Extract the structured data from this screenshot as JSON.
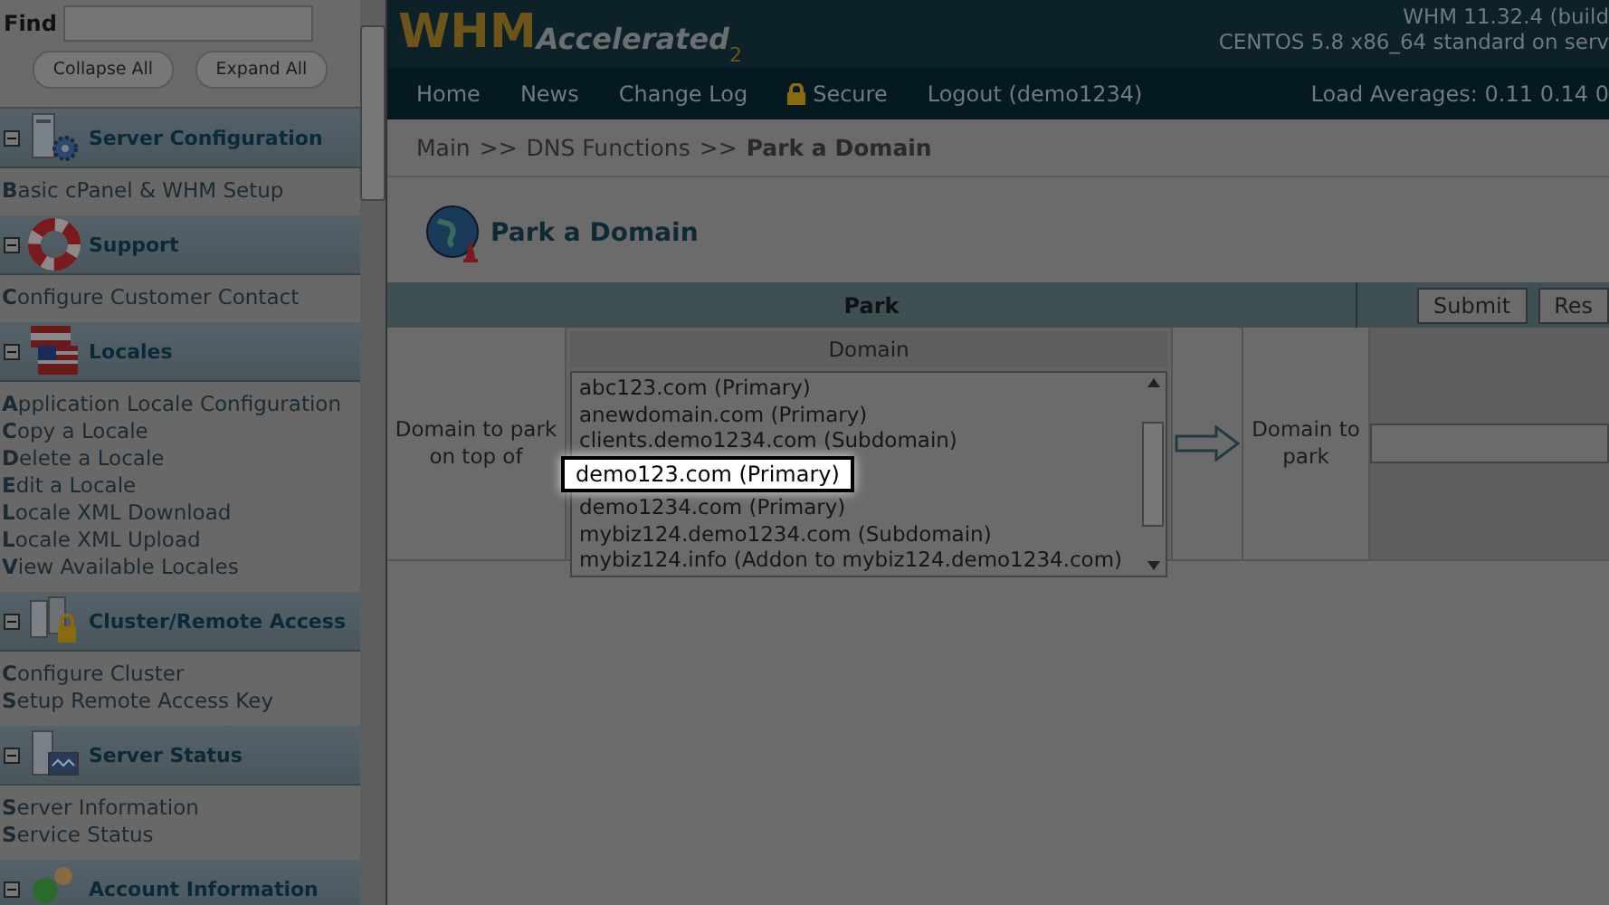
{
  "sidebar": {
    "find": {
      "label": "Find"
    },
    "buttons": [
      "Collapse All",
      "Expand All"
    ],
    "sections": [
      {
        "title": "Server Configuration",
        "expanded": true,
        "items": [
          "**B**asic cPanel & WHM Setup"
        ]
      },
      {
        "title": "Support",
        "expanded": true,
        "items": [
          "**C**onfigure Customer Contact"
        ]
      },
      {
        "title": "Locales",
        "expanded": true,
        "items": [
          "**A**pplication Locale Configuration",
          "**C**opy a Locale",
          "**D**elete a Locale",
          "**E**dit a Locale",
          "**L**ocale XML Download",
          "**L**ocale XML Upload",
          "**V**iew Available Locales"
        ]
      },
      {
        "title": "Cluster/Remote Access",
        "expanded": true,
        "items": [
          "**C**onfigure Cluster",
          "**S**etup Remote Access Key"
        ]
      },
      {
        "title": "Server Status",
        "expanded": true,
        "items": [
          "**S**erver Information",
          "**S**ervice Status"
        ]
      },
      {
        "title": "Account Information",
        "expanded": true
      }
    ]
  },
  "header": {
    "logo": {
      "main": "WHM",
      "sub": "Accelerated",
      "mark": "2"
    },
    "info": [
      "WHM 11.32.4 (build",
      "CENTOS 5.8 x86_64 standard on serv"
    ]
  },
  "nav": {
    "items": [
      {
        "label": "Home",
        "kind": "plain"
      },
      {
        "label": "News",
        "kind": "plain"
      },
      {
        "label": "Change Log",
        "kind": "plain"
      },
      {
        "label": "Secure",
        "kind": "locked"
      },
      {
        "label": "Logout (demo1234)",
        "kind": "plain"
      }
    ],
    "load": "Load Averages: 0.11 0.14 0"
  },
  "breadcrumb": {
    "items": [
      "Main",
      ">>",
      "DNS Functions",
      ">>"
    ],
    "current": "Park a Domain"
  },
  "page_title": "Park a Domain",
  "form": {
    "header": "Park",
    "buttons": [
      "Submit",
      "Res"
    ],
    "left_label": "Domain to park on top of",
    "list_header": "Domain",
    "domains": [
      {
        "name": "abc123.com (Primary)",
        "selected": false
      },
      {
        "name": "anewdomain.com (Primary)",
        "selected": false
      },
      {
        "name": "clients.demo1234.com (Subdomain)",
        "selected": false
      },
      {
        "name": "demo123.com (Primary)",
        "selected": true
      },
      {
        "name": "demo1234.com (Primary)",
        "selected": false
      },
      {
        "name": "mybiz124.demo1234.com (Subdomain)",
        "selected": false
      },
      {
        "name": "mybiz124.info (Addon to mybiz124.demo1234.com)",
        "selected": false
      }
    ],
    "right_label": "Domain to park"
  }
}
